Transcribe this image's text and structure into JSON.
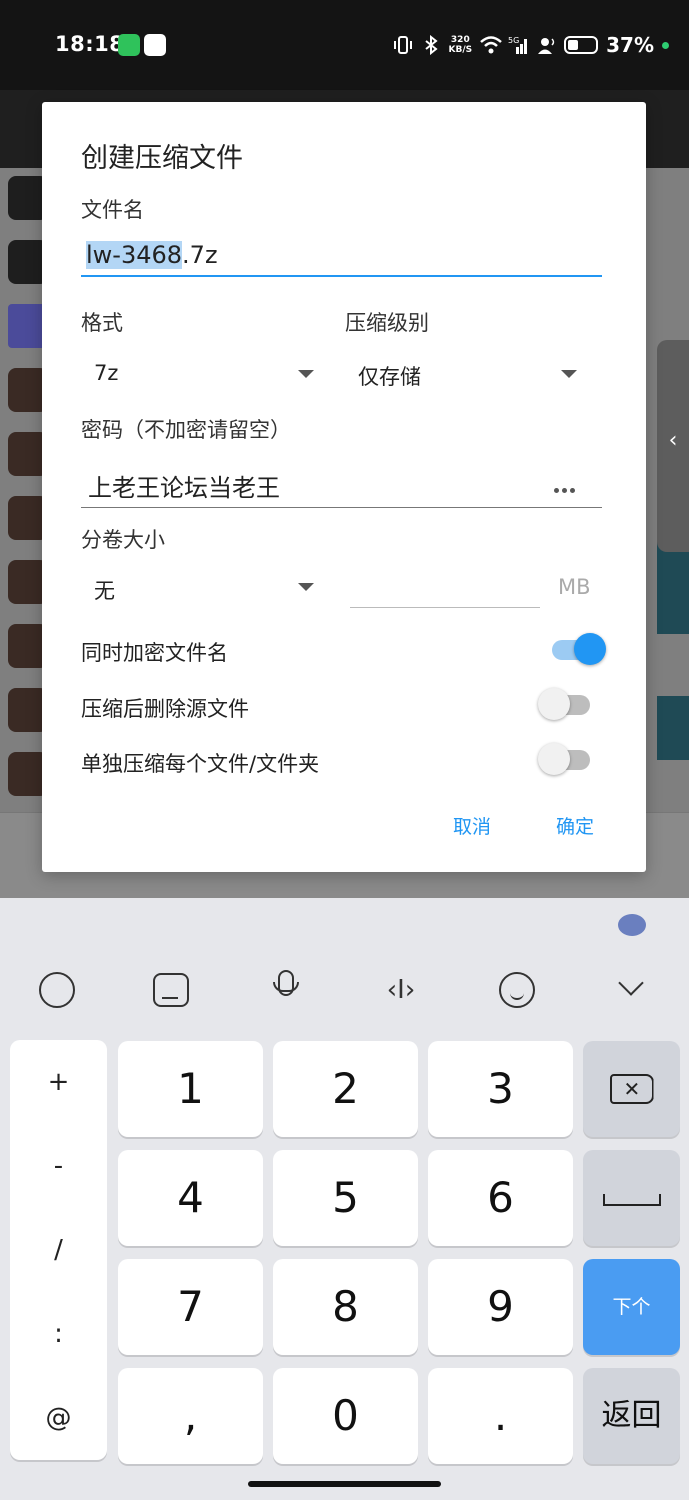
{
  "status_bar": {
    "time": "18:18",
    "net_speed": "320\nKB/S",
    "signal": "5G",
    "battery": "37%",
    "apps": [
      "wechat-icon",
      "qq-icon"
    ]
  },
  "dialog": {
    "title": "创建压缩文件",
    "filename_label": "文件名",
    "filename_selected": "lw-3468",
    "filename_ext": ".7z",
    "format_label": "格式",
    "format_value": "7z",
    "level_label": "压缩级别",
    "level_value": "仅存储",
    "password_label": "密码（不加密请留空）",
    "password_value": "上老王论坛当老王",
    "split_label": "分卷大小",
    "split_value": "无",
    "split_unit": "MB",
    "toggles": [
      {
        "label": "同时加密文件名",
        "on": true
      },
      {
        "label": "压缩后删除源文件",
        "on": false
      },
      {
        "label": "单独压缩每个文件/文件夹",
        "on": false
      }
    ],
    "cancel": "取消",
    "ok": "确定"
  },
  "keyboard": {
    "symbols": [
      "+",
      "-",
      "/",
      ":",
      "@"
    ],
    "digits": [
      "1",
      "2",
      "3",
      "4",
      "5",
      "6",
      "7",
      "8",
      "9",
      "0"
    ],
    "comma": ",",
    "dot": ".",
    "next": "下个",
    "back": "返回",
    "toolbar_glyph": "‹I›"
  },
  "colors": {
    "accent": "#2196f3",
    "action_key": "#4a9cf2"
  }
}
